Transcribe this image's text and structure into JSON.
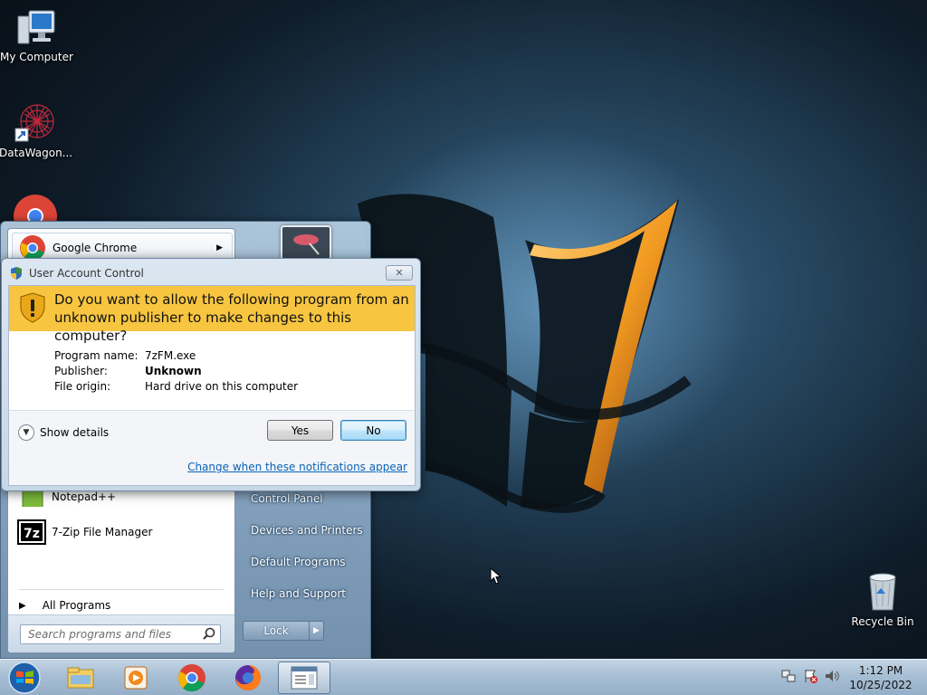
{
  "desktop": {
    "icons": [
      {
        "label": "My Computer",
        "icon": "computer-icon"
      },
      {
        "label": "DataWagon...",
        "icon": "datawagon-icon"
      },
      {
        "label": "Recycle Bin",
        "icon": "recycle-bin-icon"
      }
    ]
  },
  "start_menu": {
    "pinned": {
      "label": "Google Chrome",
      "icon": "chrome-icon"
    },
    "recent": [
      {
        "label": "Notepad++",
        "icon": "notepadpp-icon"
      },
      {
        "label": "7-Zip File Manager",
        "icon": "7zip-icon"
      }
    ],
    "all_programs": "All Programs",
    "search_placeholder": "Search programs and files",
    "right_items": [
      {
        "label": "Control Panel"
      },
      {
        "label": "Devices and Printers"
      },
      {
        "label": "Default Programs"
      },
      {
        "label": "Help and Support"
      }
    ],
    "lock_label": "Lock"
  },
  "uac": {
    "title": "User Account Control",
    "question": "Do you want to allow the following program from an unknown publisher to make changes to this computer?",
    "fields": [
      {
        "key": "Program name:",
        "value": "7zFM.exe"
      },
      {
        "key": "Publisher:",
        "value": "Unknown"
      },
      {
        "key": "File origin:",
        "value": "Hard drive on this computer"
      }
    ],
    "show_details": "Show details",
    "yes": "Yes",
    "no": "No",
    "link": "Change when these notifications appear"
  },
  "taskbar": {
    "apps": [
      "file-explorer-icon",
      "media-player-icon",
      "chrome-icon",
      "firefox-icon",
      "app-window-icon"
    ],
    "tray": [
      "network-icon",
      "action-center-icon",
      "volume-icon"
    ],
    "time": "1:12 PM",
    "date": "10/25/2022"
  },
  "colors": {
    "uac_banner": "#f7c540",
    "link": "#0b63b8",
    "logo_orange": "#f0a020"
  }
}
